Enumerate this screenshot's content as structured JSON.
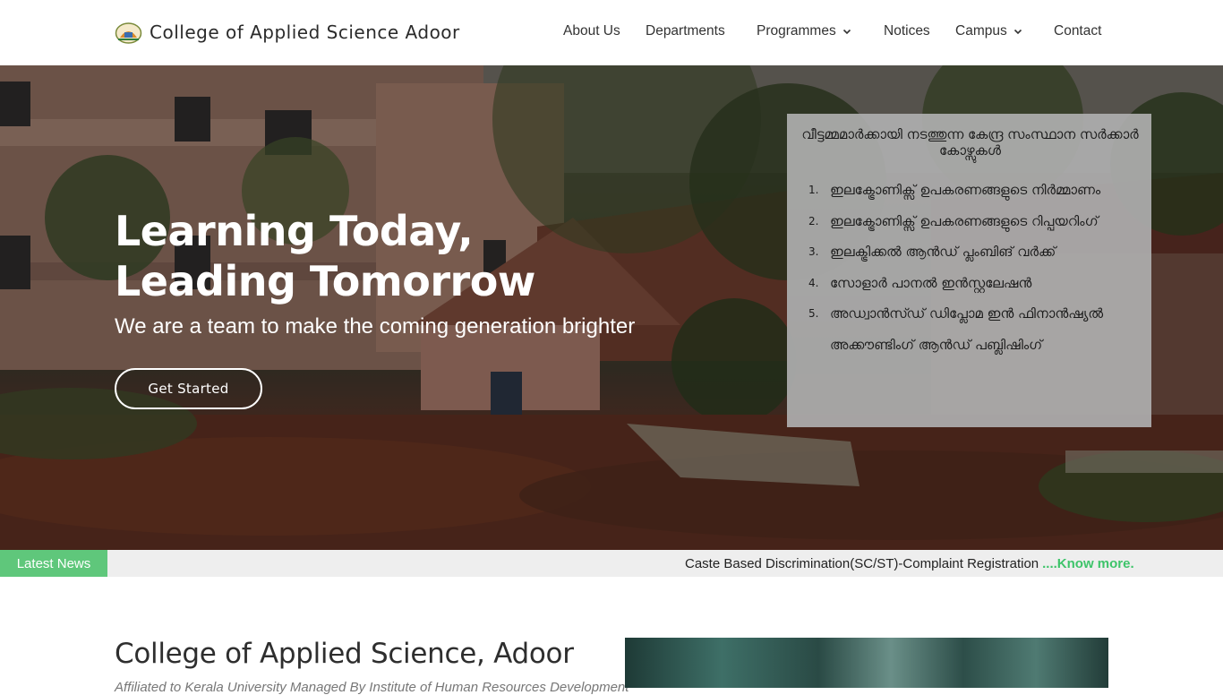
{
  "header": {
    "site_title": "College of Applied Science Adoor",
    "nav": [
      {
        "label": "About Us",
        "has_dropdown": false
      },
      {
        "label": "Departments",
        "has_dropdown": false
      },
      {
        "label": "Programmes",
        "has_dropdown": true
      },
      {
        "label": "Notices",
        "has_dropdown": false
      },
      {
        "label": "Campus",
        "has_dropdown": true
      },
      {
        "label": "Contact",
        "has_dropdown": false
      }
    ]
  },
  "hero": {
    "title_line1": "Learning Today,",
    "title_line2": "Leading Tomorrow",
    "subtitle": "We are a team to make the coming generation brighter",
    "button_label": "Get Started"
  },
  "notice": {
    "title": "വീട്ടമ്മമാർക്കായി നടത്തുന്ന കേന്ദ്ര സംസ്ഥാന സർക്കാർ കോഴ്സുകൾ",
    "items": [
      {
        "num": "1.",
        "text": "ഇലക്ട്രോണിക്സ് ഉപകരണങ്ങളുടെ നിർമ്മാണം"
      },
      {
        "num": "2.",
        "text": "ഇലക്ട്രോണിക്സ് ഉപകരണങ്ങളുടെ റിപ്പയറിംഗ്"
      },
      {
        "num": "3.",
        "text": "ഇലക്ട്രിക്കൽ ആൻഡ് പ്ലംബിങ് വർക്ക്"
      },
      {
        "num": "4.",
        "text": "സോളാർ പാനൽ ഇൻസ്റ്റലേഷൻ"
      },
      {
        "num": "5.",
        "text": "അഡ്വാൻസ്ഡ് ഡിപ്ലോമ ഇൻ ഫിനാൻഷ്യൽ അക്കൗണ്ടിംഗ് ആൻഡ് പബ്ലിഷിംഗ്"
      }
    ]
  },
  "ticker": {
    "label": "Latest News",
    "text": "Caste Based Discrimination(SC/ST)-Complaint Registration",
    "link": "....Know more."
  },
  "intro": {
    "title": "College of Applied Science, Adoor",
    "subtitle": "Affiliated to Kerala University Managed By Institute of Human Resources Development"
  },
  "colors": {
    "accent_green": "#5fc77b",
    "link_green": "#3ec46a",
    "notice_bg": "#afafaf"
  }
}
